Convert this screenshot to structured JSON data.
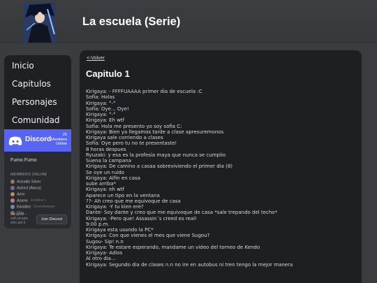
{
  "header": {
    "title": "La escuela (Serie)"
  },
  "sidebar": {
    "items": [
      {
        "label": "Inicio"
      },
      {
        "label": "Capitulos"
      },
      {
        "label": "Personajes"
      },
      {
        "label": "Comunidad"
      }
    ]
  },
  "discord_widget": {
    "brand": "Discord",
    "member_count": "25",
    "member_count_label": "Members",
    "online_label": "Online",
    "server_name": "Fumo Fumo",
    "members_heading": "MEMBERS ONLINE",
    "members": [
      {
        "name": "Actually Silver",
        "game": ""
      },
      {
        "name": "Astord (Alaca)",
        "game": ""
      },
      {
        "name": "Aére",
        "game": ""
      },
      {
        "name": "Asana",
        "game": "Hololive i"
      },
      {
        "name": "BäraBot",
        "game": "Scorekeeper"
      },
      {
        "name": "Cha...",
        "game": ""
      }
    ],
    "footer_text": [
      "Hangout",
      "with people",
      "who get it"
    ],
    "join_label": "Join Discord",
    "accent": "#5865f2"
  },
  "content": {
    "back_link": "<-Volver",
    "chapter_title": "Capitulo 1",
    "lines": [
      "Kirigaya: - FFFFUAAAA primer dia de escuela :C",
      "Sofia: Holas",
      "Kirigaya: °-°",
      "Sofia: Oye... Oye!",
      "Kirigaya: °-°",
      "Kirigaya: Eh wtf",
      "Sofia: Hola me presento yo soy sofia C:",
      "Kirigaya: Bien ya llegamos tarde a clase apresuremonos",
      "Kirigaya sale corriendo a clases",
      "Sofia: Oye pero tu no te presentaste!",
      "8 horas despues",
      "Ryuzaki: y esa es la profesia maya que nunca se cumplio",
      "Suena la campana",
      "Kirigaya: De camino a casaa sobreviviendo el primer dia (8)",
      "Se oye un ruido",
      "Kirigaya: Alfin en casa",
      "sube arriba*",
      "Kirigaya: eh wtf",
      "Aparece un tipo en la ventana",
      "??- Ah creo que me equivoque de casa",
      "Kirigaya: -Y tu kien ere?",
      "Dante- Soy dante y creo que me equivoque de casa *sale trepando del techo*",
      "Kirigaya: -Pero que! Assassin´s creed es real!",
      "9:00 p.m.",
      "Kirigaya esta usando la PC*",
      "Kirigaya: Con que vienes el mes que viene Sugou?",
      "Sugou- Sip! n.n",
      "Kirigaya: Te estare esperando, mandame un video del torneo de Kendo",
      "Kirigaya- Adios",
      "Al otro dia...",
      "Kirigaya: Segundo dia de clases n.n no ire en autobus ni tren tengo la mejor manera"
    ]
  },
  "colors": {
    "page_bg": "#3a3c40",
    "panel_bg": "#1e1f22",
    "text": "#d8d8d8"
  }
}
